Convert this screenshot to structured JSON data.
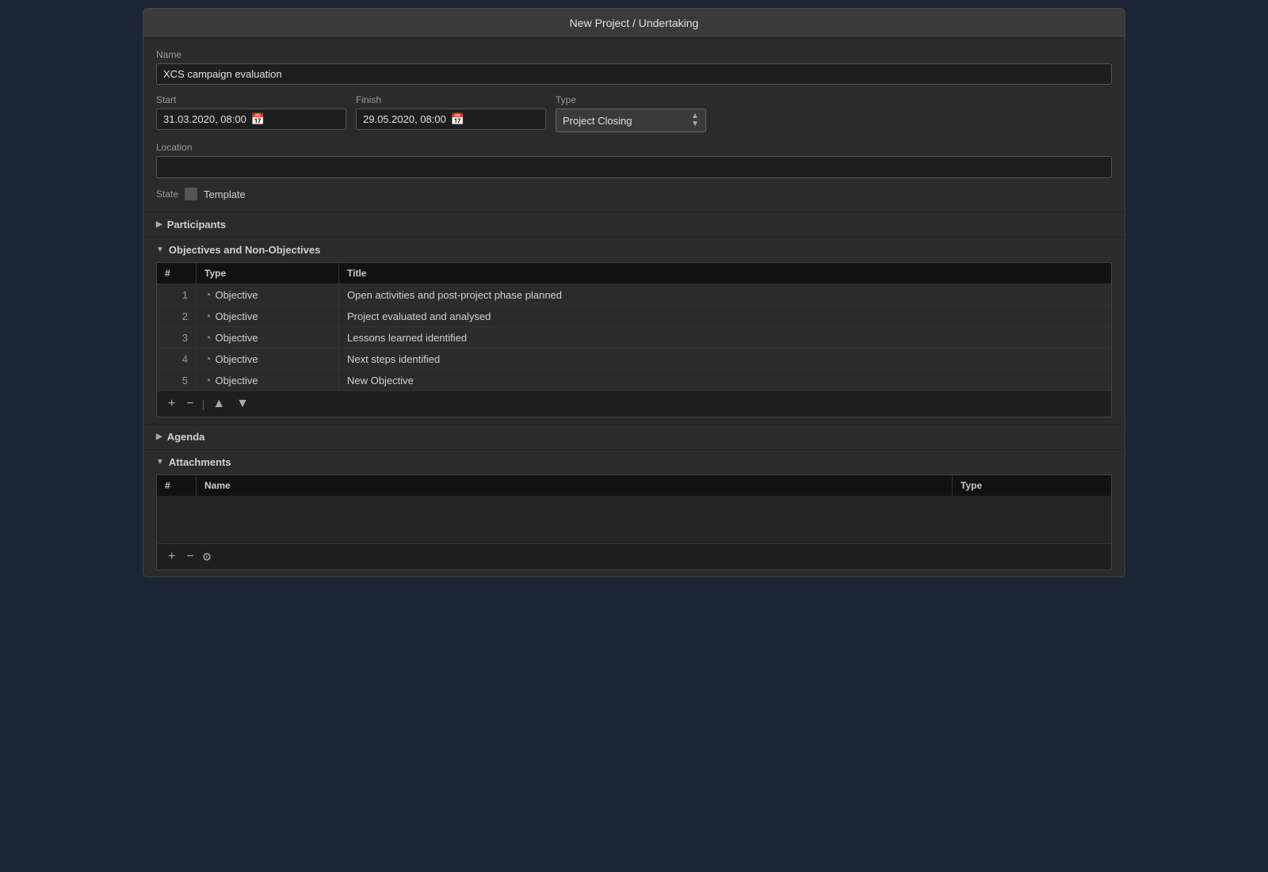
{
  "window": {
    "title": "New Project / Undertaking"
  },
  "form": {
    "name_label": "Name",
    "name_value": "XCS campaign evaluation",
    "start_label": "Start",
    "start_value": "31.03.2020, 08:00",
    "finish_label": "Finish",
    "finish_value": "29.05.2020, 08:00",
    "type_label": "Type",
    "type_value": "Project Closing",
    "location_label": "Location",
    "location_value": "",
    "state_label": "State",
    "state_value": "Template"
  },
  "sections": {
    "participants_label": "Participants",
    "objectives_label": "Objectives and Non-Objectives",
    "agenda_label": "Agenda",
    "attachments_label": "Attachments"
  },
  "objectives_table": {
    "col_num": "#",
    "col_type": "Type",
    "col_title": "Title",
    "rows": [
      {
        "num": "1",
        "type": "Objective",
        "title": "Open activities and post-project phase planned"
      },
      {
        "num": "2",
        "type": "Objective",
        "title": "Project evaluated and analysed"
      },
      {
        "num": "3",
        "type": "Objective",
        "title": "Lessons learned identified"
      },
      {
        "num": "4",
        "type": "Objective",
        "title": "Next steps identified"
      },
      {
        "num": "5",
        "type": "Objective",
        "title": "New Objective"
      }
    ]
  },
  "attachments_table": {
    "col_num": "#",
    "col_name": "Name",
    "col_type": "Type"
  },
  "toolbar": {
    "add": "+",
    "remove": "−",
    "up": "▲",
    "down": "▼",
    "sep": "|"
  }
}
